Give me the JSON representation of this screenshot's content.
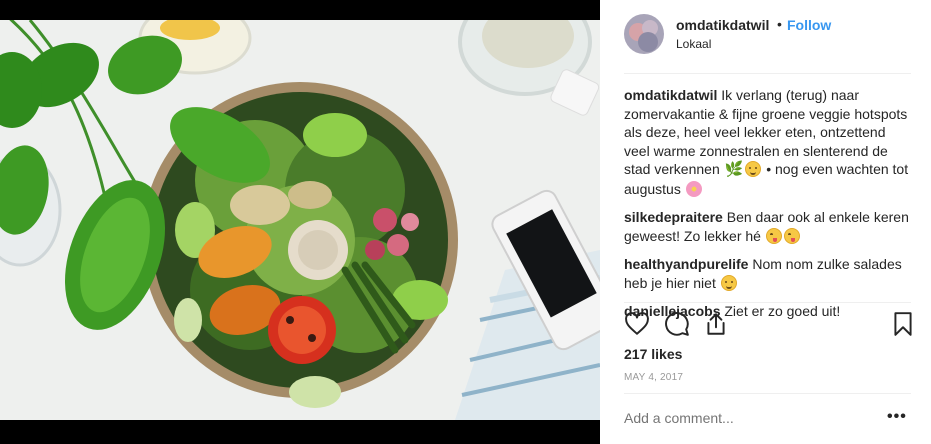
{
  "post": {
    "username": "omdatikdatwil",
    "separator": "•",
    "follow_label": "Follow",
    "location": "Lokaal",
    "likes": "217 likes",
    "date": "MAY 4, 2017",
    "add_comment_placeholder": "Add a comment...",
    "more_label": "•••",
    "caption": {
      "user": "omdatikdatwil",
      "text_1": "Ik verlang (terug) naar zomervakantie & fijne groene veggie hotspots als deze, heel veel lekker eten, ontzettend veel warme zonnestralen en slenterend de stad verkennen",
      "text_2": "• nog even wachten tot augustus"
    },
    "comments": [
      {
        "user": "silkedepraitere",
        "text": "Ben daar ook al enkele keren geweest! Zo lekker hé"
      },
      {
        "user": "healthyandpurelife",
        "text": "Nom nom zulke salades heb je hier niet"
      },
      {
        "user": "daniellejacobs",
        "text": "Ziet er zo goed uit!"
      }
    ]
  },
  "icons": {
    "avatar": "avatar",
    "like": "heart-icon",
    "comment": "comment-icon",
    "share": "share-icon",
    "save": "bookmark-icon",
    "emoji_leaf": "herb-emoji",
    "emoji_smile": "smiling-face-emoji",
    "emoji_yum": "yum-face-emoji",
    "emoji_flower": "cherry-blossom-emoji"
  },
  "colors": {
    "accent": "#3897f0",
    "text": "#262626",
    "muted": "#999999",
    "divider": "#efefef"
  }
}
